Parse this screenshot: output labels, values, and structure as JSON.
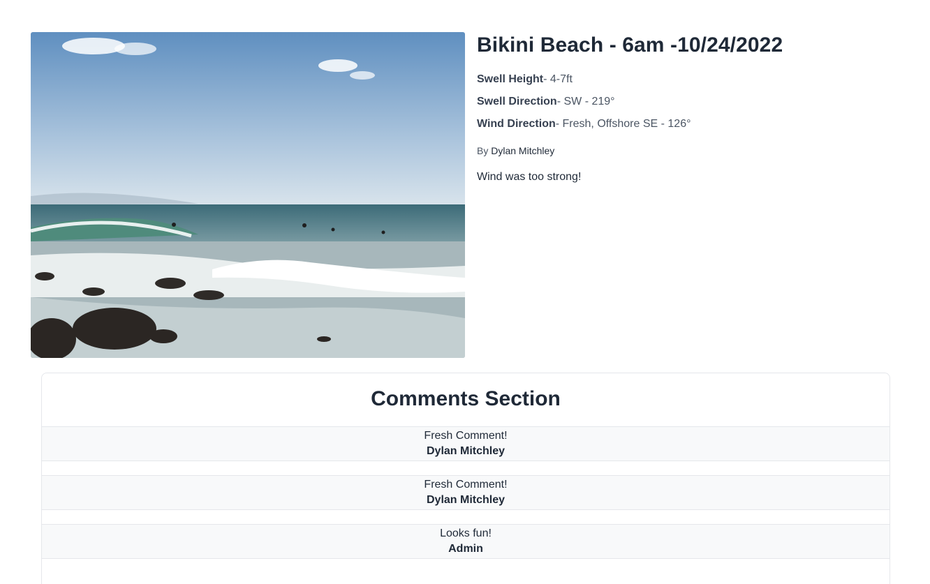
{
  "session": {
    "title": "Bikini Beach - 6am -10/24/2022",
    "swell_height_label": "Swell Height",
    "swell_height_value": "- 4-7ft",
    "swell_direction_label": "Swell Direction",
    "swell_direction_value": "- SW - 219°",
    "wind_direction_label": "Wind Direction",
    "wind_direction_value": "- Fresh, Offshore SE - 126°",
    "by_label": "By",
    "author": "Dylan Mitchley",
    "note": "Wind was too strong!"
  },
  "comments": {
    "title": "Comments Section",
    "items": [
      {
        "text": "Fresh Comment!",
        "author": "Dylan Mitchley"
      },
      {
        "text": "Fresh Comment!",
        "author": "Dylan Mitchley"
      },
      {
        "text": "Looks fun!",
        "author": "Admin"
      }
    ]
  }
}
